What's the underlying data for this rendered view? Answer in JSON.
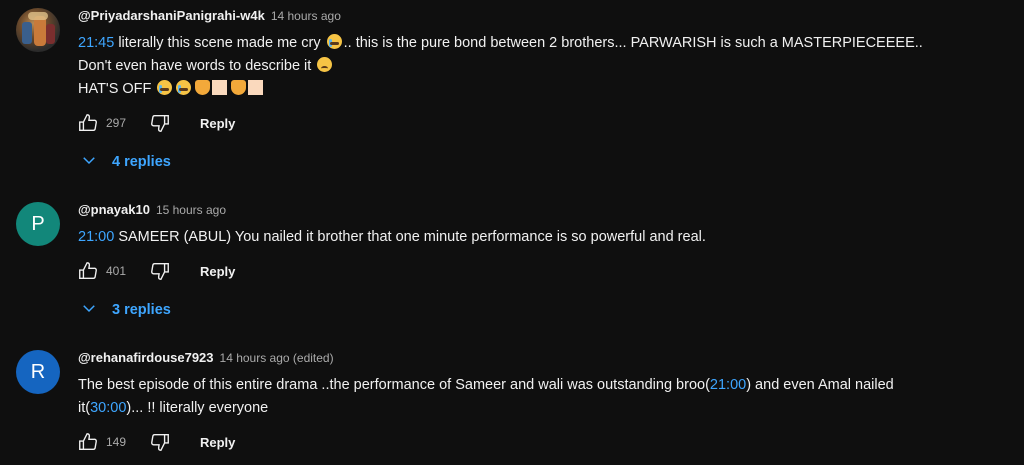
{
  "comments": [
    {
      "author": "@PriyadarshaniPanigrahi-w4k",
      "time": "14 hours ago",
      "avatar_type": "photo",
      "line1_ts": "21:45",
      "line1_a": "literally this scene made me cry",
      "line1_b": ".. this is the pure bond between 2 brothers... PARWARISH is such a MASTERPIECEEEE..",
      "line2": "Don't even  have words to describe it",
      "line3": "HAT'S OFF",
      "likes": "297",
      "reply_label": "Reply",
      "replies_label": "4 replies"
    },
    {
      "author": "@pnayak10",
      "time": "15 hours ago",
      "avatar_letter": "P",
      "avatar_color": "#12877a",
      "line1_ts": "21:00",
      "line1_a": "SAMEER (ABUL) You nailed it brother that one minute performance is so powerful and real.",
      "likes": "401",
      "reply_label": "Reply",
      "replies_label": "3 replies"
    },
    {
      "author": "@rehanafirdouse7923",
      "time": "14 hours ago (edited)",
      "avatar_letter": "R",
      "avatar_color": "#1565c0",
      "line1_a": "The best episode of this entire drama ..the performance of Sameer and wali was outstanding broo(",
      "line1_ts": "21:00",
      "line1_b": ") and even Amal nailed",
      "line2_a": "it(",
      "line2_ts": "30:00",
      "line2_b": ")... !! literally everyone",
      "likes": "149",
      "reply_label": "Reply"
    }
  ],
  "icons": {
    "like": "thumbs-up-icon",
    "dislike": "thumbs-down-icon",
    "expand": "chevron-down-icon",
    "emoji_cry": "loudly-crying-face-icon",
    "emoji_sad": "sad-face-icon",
    "emoji_hands": "heart-hands-icon",
    "skin_tone": "skin-tone-modifier-icon"
  },
  "colors": {
    "background": "#0f0f0f",
    "text": "#f1f1f1",
    "secondary_text": "#aaaaaa",
    "link": "#3ea6ff"
  }
}
